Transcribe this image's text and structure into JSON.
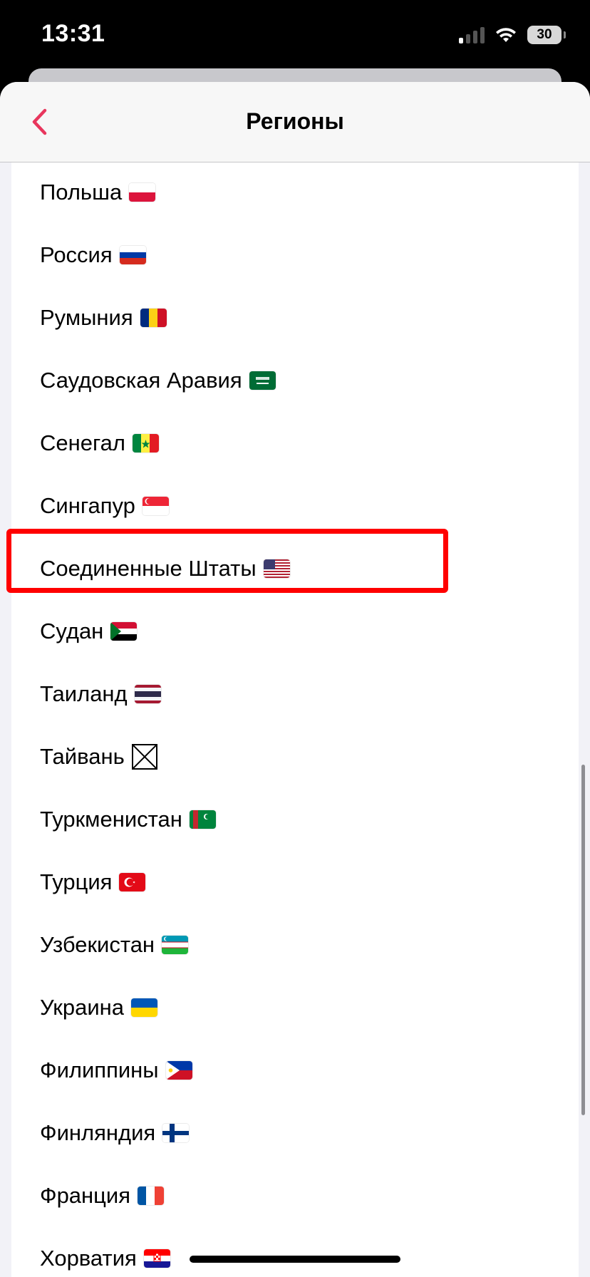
{
  "status_bar": {
    "time": "13:31",
    "battery": "30",
    "signal_icon": "cellular-signal-icon",
    "wifi_icon": "wifi-icon"
  },
  "nav": {
    "title": "Регионы",
    "back_icon": "chevron-left-icon",
    "accent_color": "#e8365d"
  },
  "regions": [
    {
      "name": "Польша",
      "flag": "poland"
    },
    {
      "name": "Россия",
      "flag": "russia"
    },
    {
      "name": "Румыния",
      "flag": "romania"
    },
    {
      "name": "Саудовская Аравия",
      "flag": "saudi-arabia"
    },
    {
      "name": "Сенегал",
      "flag": "senegal"
    },
    {
      "name": "Сингапур",
      "flag": "singapore"
    },
    {
      "name": "Соединенные Штаты",
      "flag": "united-states",
      "highlighted": true
    },
    {
      "name": "Судан",
      "flag": "sudan"
    },
    {
      "name": "Таиланд",
      "flag": "thailand"
    },
    {
      "name": "Тайвань",
      "flag": "missing-glyph"
    },
    {
      "name": "Туркменистан",
      "flag": "turkmenistan"
    },
    {
      "name": "Турция",
      "flag": "turkey"
    },
    {
      "name": "Узбекистан",
      "flag": "uzbekistan"
    },
    {
      "name": "Украина",
      "flag": "ukraine"
    },
    {
      "name": "Филиппины",
      "flag": "philippines"
    },
    {
      "name": "Финляндия",
      "flag": "finland"
    },
    {
      "name": "Франция",
      "flag": "france"
    },
    {
      "name": "Хорватия",
      "flag": "croatia"
    }
  ],
  "highlight_color": "#ff0000"
}
